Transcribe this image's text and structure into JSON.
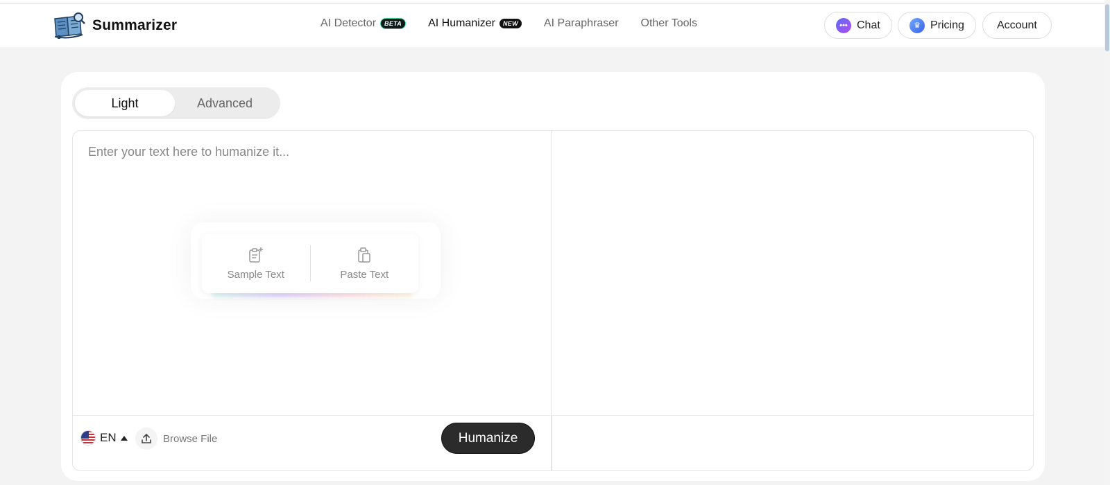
{
  "header": {
    "brand": "Summarizer",
    "nav": [
      {
        "label": "AI Detector",
        "badge": "BETA",
        "active": false
      },
      {
        "label": "AI Humanizer",
        "badge": "NEW",
        "active": true
      },
      {
        "label": "AI Paraphraser",
        "badge": null,
        "active": false
      },
      {
        "label": "Other Tools",
        "badge": null,
        "active": false
      }
    ],
    "chat_label": "Chat",
    "pricing_label": "Pricing",
    "account_label": "Account"
  },
  "mode_toggle": {
    "options": [
      "Light",
      "Advanced"
    ],
    "selected": "Light"
  },
  "input": {
    "placeholder": "Enter your text here to humanize it...",
    "value": ""
  },
  "quick_actions": {
    "sample_label": "Sample Text",
    "paste_label": "Paste Text"
  },
  "bottom_bar": {
    "language": "EN",
    "browse_label": "Browse File",
    "humanize_label": "Humanize"
  },
  "colors": {
    "accent_dark": "#2b2b2b",
    "chat_gradient": [
      "#5b6cf5",
      "#b44cf0"
    ],
    "pricing_gradient": [
      "#6fa8ff",
      "#3a63e8"
    ]
  }
}
